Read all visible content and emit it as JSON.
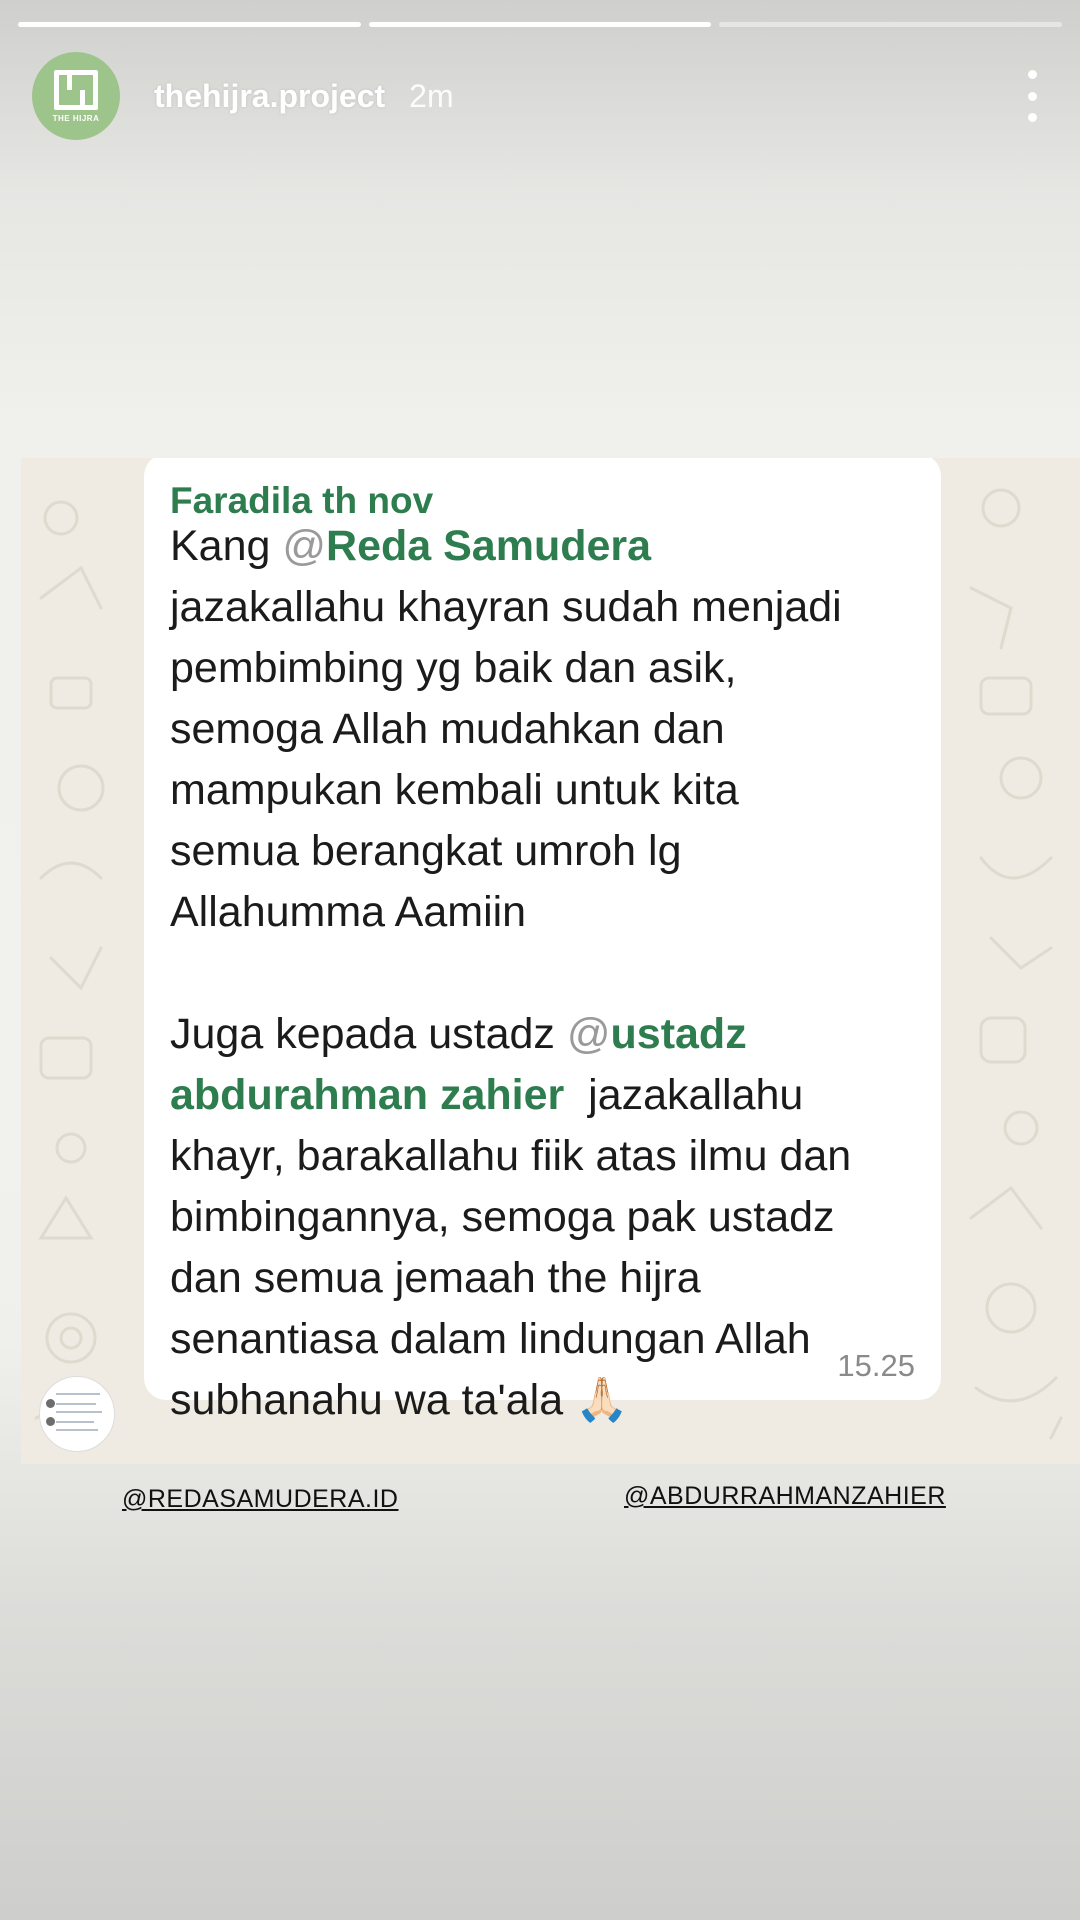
{
  "story": {
    "progress": [
      1.0,
      1.0,
      0.0
    ],
    "account": {
      "avatar_text": "THE HIJRA",
      "username": "thehijra.project",
      "time_ago": "2m"
    },
    "more_icon": "more-vertical-icon"
  },
  "chat": {
    "sender": "Faradila th nov",
    "paragraph1": {
      "prefix": "Kang ",
      "at": "@",
      "mention": "Reda Samudera",
      "lines": [
        "jazakallahu khayran sudah menjadi",
        "pembimbing yg baik dan asik,",
        "semoga Allah mudahkan dan",
        "mampukan kembali untuk kita",
        "semua berangkat umroh lg",
        "Allahumma Aamiin"
      ]
    },
    "paragraph2": {
      "prefix": "Juga kepada ustadz ",
      "at": "@",
      "mention_part1": "ustadz",
      "mention_part2": "abdurahman zahier",
      "after_mention": "  jazakallahu",
      "lines": [
        "khayr, barakallahu fiik atas ilmu dan",
        "bimbingannya, semoga pak ustadz",
        "dan semua jemaah the hijra",
        "senantiasa dalam lindungan Allah"
      ],
      "last_line": "subhanahu wa ta'ala ",
      "emoji": "🙏🏻"
    },
    "time": "15.25",
    "colors": {
      "mention": "#2e7d4f",
      "chat_background": "#efeae2"
    }
  },
  "tags": {
    "left": "@REDASAMUDERA.ID",
    "right": "@ABDURRAHMANZAHIER"
  }
}
